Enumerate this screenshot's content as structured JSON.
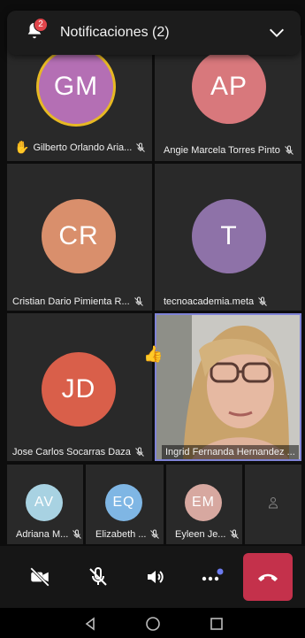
{
  "notification": {
    "title": "Notificaciones (2)",
    "badge_count": "2"
  },
  "participants": {
    "gm": {
      "initials": "GM",
      "name": "Gilberto Orlando Aria...",
      "color": "#b46fb4",
      "speaking": true,
      "hand_raised": true
    },
    "ap": {
      "initials": "AP",
      "name": "Angie Marcela Torres Pinto",
      "color": "#d8787c"
    },
    "cr": {
      "initials": "CR",
      "name": "Cristian Dario Pimienta R...",
      "color": "#d98f6c"
    },
    "t": {
      "initials": "T",
      "name": "tecnoacademia.meta",
      "color": "#8e72a8"
    },
    "jd": {
      "initials": "JD",
      "name": "Jose Carlos Socarras Daza",
      "color": "#d95f4a"
    },
    "ih": {
      "name": "Ingrid Fernanda Hernandez ..."
    }
  },
  "small_tiles": {
    "av": {
      "initials": "AV",
      "name": "Adriana M...",
      "color": "#a8d2e2"
    },
    "eq": {
      "initials": "EQ",
      "name": "Elizabeth ...",
      "color": "#7fb6e4"
    },
    "em": {
      "initials": "EM",
      "name": "Eyleen Je...",
      "color": "#d7a8a0"
    }
  },
  "icons": {
    "bell": "bell-icon",
    "chevron": "chevron-down-icon",
    "hand": "raised-hand-icon",
    "thumbs": "thumbs-up-icon",
    "mic_off": "mic-off-icon",
    "camera_off": "camera-off-icon",
    "speaker": "speaker-icon",
    "more": "more-icon",
    "hangup": "hang-up-icon",
    "person": "person-icon"
  },
  "colors": {
    "hangup": "#c4314b",
    "active_border": "#7f83d6",
    "speaking_ring": "#e7b923"
  }
}
